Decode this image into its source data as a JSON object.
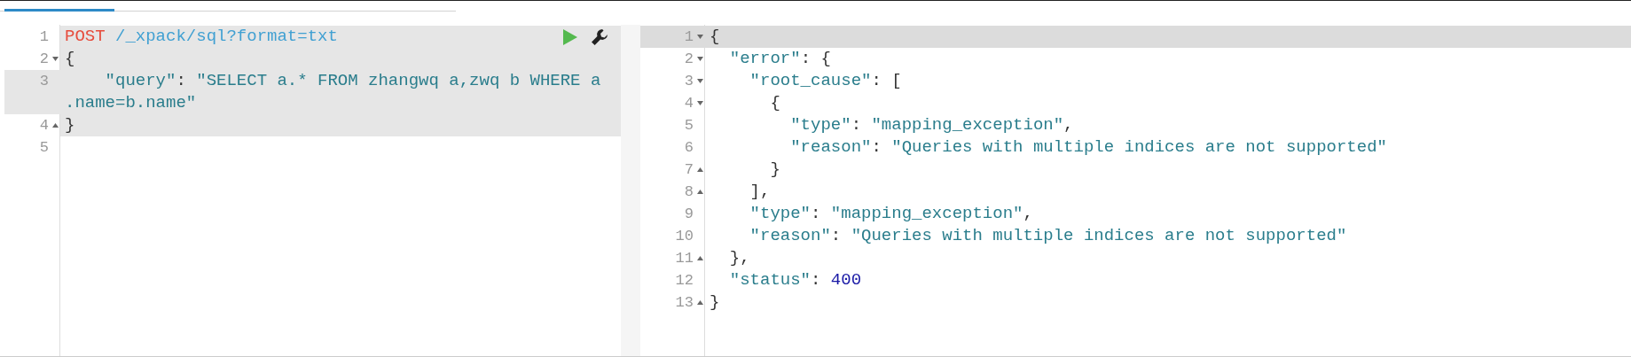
{
  "request_editor": {
    "lines": [
      {
        "number": "1",
        "fold_start": false,
        "fold_end": false,
        "active": false,
        "in_request": true,
        "tokens": [
          {
            "kind": "method",
            "text": "POST"
          },
          {
            "kind": "url",
            "text": " /_xpack/sql?format=txt"
          }
        ]
      },
      {
        "number": "2",
        "fold_start": true,
        "fold_end": false,
        "active": false,
        "in_request": true,
        "tokens": [
          {
            "kind": "punct",
            "text": "{"
          }
        ]
      },
      {
        "number": "3",
        "fold_start": false,
        "fold_end": false,
        "active": true,
        "in_request": true,
        "tokens": [
          {
            "kind": "key",
            "text": "    \"query\""
          },
          {
            "kind": "punct",
            "text": ": "
          },
          {
            "kind": "string",
            "text": "\"SELECT a.* FROM zhangwq a,zwq b WHERE a"
          },
          {
            "kind": "string",
            "text": ".name=b.name\"",
            "wrap": true
          }
        ]
      },
      {
        "number": "4",
        "fold_start": false,
        "fold_end": true,
        "active": false,
        "in_request": true,
        "tokens": [
          {
            "kind": "punct",
            "text": "}"
          }
        ]
      },
      {
        "number": "5",
        "fold_start": false,
        "fold_end": false,
        "active": false,
        "in_request": false
      }
    ]
  },
  "response_editor": {
    "lines": [
      {
        "number": "1",
        "fold_start": true,
        "fold_end": false,
        "active": true,
        "tokens": [
          {
            "kind": "punct",
            "text": "{"
          }
        ]
      },
      {
        "number": "2",
        "fold_start": true,
        "fold_end": false,
        "active": false,
        "tokens": [
          {
            "kind": "key",
            "text": "  \"error\""
          },
          {
            "kind": "punct",
            "text": ": {"
          }
        ]
      },
      {
        "number": "3",
        "fold_start": true,
        "fold_end": false,
        "active": false,
        "tokens": [
          {
            "kind": "key",
            "text": "    \"root_cause\""
          },
          {
            "kind": "punct",
            "text": ": ["
          }
        ]
      },
      {
        "number": "4",
        "fold_start": true,
        "fold_end": false,
        "active": false,
        "tokens": [
          {
            "kind": "punct",
            "text": "      {"
          }
        ]
      },
      {
        "number": "5",
        "fold_start": false,
        "fold_end": false,
        "active": false,
        "tokens": [
          {
            "kind": "key",
            "text": "        \"type\""
          },
          {
            "kind": "punct",
            "text": ": "
          },
          {
            "kind": "string",
            "text": "\"mapping_exception\""
          },
          {
            "kind": "punct",
            "text": ","
          }
        ]
      },
      {
        "number": "6",
        "fold_start": false,
        "fold_end": false,
        "active": false,
        "tokens": [
          {
            "kind": "key",
            "text": "        \"reason\""
          },
          {
            "kind": "punct",
            "text": ": "
          },
          {
            "kind": "string",
            "text": "\"Queries with multiple indices are not supported\""
          }
        ]
      },
      {
        "number": "7",
        "fold_start": false,
        "fold_end": true,
        "active": false,
        "tokens": [
          {
            "kind": "punct",
            "text": "      }"
          }
        ]
      },
      {
        "number": "8",
        "fold_start": false,
        "fold_end": true,
        "active": false,
        "tokens": [
          {
            "kind": "punct",
            "text": "    ],"
          }
        ]
      },
      {
        "number": "9",
        "fold_start": false,
        "fold_end": false,
        "active": false,
        "tokens": [
          {
            "kind": "key",
            "text": "    \"type\""
          },
          {
            "kind": "punct",
            "text": ": "
          },
          {
            "kind": "string",
            "text": "\"mapping_exception\""
          },
          {
            "kind": "punct",
            "text": ","
          }
        ]
      },
      {
        "number": "10",
        "fold_start": false,
        "fold_end": false,
        "active": false,
        "tokens": [
          {
            "kind": "key",
            "text": "    \"reason\""
          },
          {
            "kind": "punct",
            "text": ": "
          },
          {
            "kind": "string",
            "text": "\"Queries with multiple indices are not supported\""
          }
        ]
      },
      {
        "number": "11",
        "fold_start": false,
        "fold_end": true,
        "active": false,
        "tokens": [
          {
            "kind": "punct",
            "text": "  },"
          }
        ]
      },
      {
        "number": "12",
        "fold_start": false,
        "fold_end": false,
        "active": false,
        "tokens": [
          {
            "kind": "key",
            "text": "  \"status\""
          },
          {
            "kind": "punct",
            "text": ": "
          },
          {
            "kind": "number",
            "text": "400"
          }
        ]
      },
      {
        "number": "13",
        "fold_start": false,
        "fold_end": true,
        "active": false,
        "tokens": [
          {
            "kind": "punct",
            "text": "}"
          }
        ]
      }
    ]
  }
}
